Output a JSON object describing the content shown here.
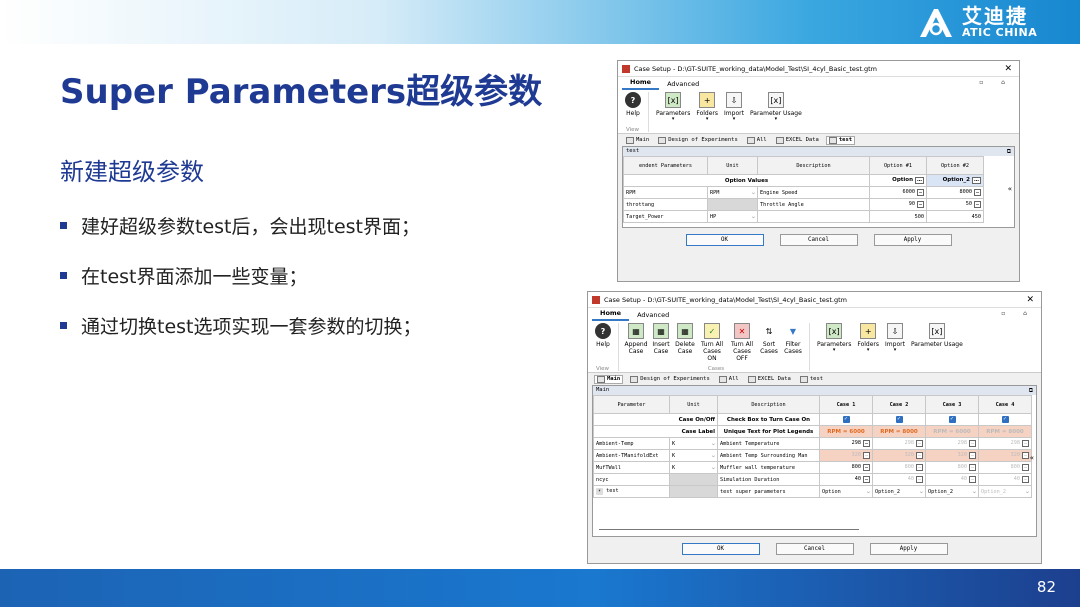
{
  "logo": {
    "cn": "艾迪捷",
    "en": "ATIC CHINA"
  },
  "slide": {
    "title": "Super Parameters超级参数",
    "subtitle": "新建超级参数",
    "bullets": [
      "建好超级参数test后，会出现test界面；",
      "在test界面添加一些变量；",
      "通过切换test选项实现一套参数的切换；"
    ],
    "page_number": "82"
  },
  "colors": {
    "title": "#1f3a93",
    "accent": "#1a78cf",
    "checkbox": "#2f6fc2"
  },
  "dialog1": {
    "title": "Case Setup - D:\\GT-SUITE_working_data\\Model_Test\\SI_4cyl_Basic_test.gtm",
    "close": "✕",
    "menu": [
      "Home",
      "Advanced"
    ],
    "menu_right": "▫ ⌂",
    "ribbon": {
      "help": "Help",
      "parameters": "Parameters",
      "folders": "Folders",
      "import": "Import",
      "parameter_usage": "Parameter Usage",
      "view_group": "View"
    },
    "tabs": [
      "Main",
      "Design of Experiments",
      "All",
      "EXCEL Data",
      "test"
    ],
    "panel_title": "test",
    "headers": [
      "endent Parameters",
      "Unit",
      "Description",
      "Option #1",
      "Option #2"
    ],
    "option_values_label": "Option Values",
    "option_values": [
      "Option",
      "Option_2"
    ],
    "rows": [
      {
        "name": "RPM",
        "unit": "RPM",
        "desc": "Engine Speed",
        "v1": "6000",
        "v2": "8000"
      },
      {
        "name": "throttang",
        "unit": "",
        "desc": "Throttle Angle",
        "v1": "90",
        "v2": "50"
      },
      {
        "name": "Target_Power",
        "unit": "HP",
        "desc": "",
        "v1": "500",
        "v2": "450"
      }
    ],
    "buttons": [
      "OK",
      "Cancel",
      "Apply"
    ]
  },
  "dialog2": {
    "title": "Case Setup - D:\\GT-SUITE_working_data\\Model_Test\\SI_4cyl_Basic_test.gtm",
    "close": "✕",
    "menu": [
      "Home",
      "Advanced"
    ],
    "menu_right": "▫ ⌂",
    "ribbon": {
      "help": "Help",
      "append": "Append Case",
      "insert": "Insert Case",
      "delete": "Delete Case",
      "turn_on": "Turn All Cases ON",
      "turn_off": "Turn All Cases OFF",
      "sort": "Sort Cases",
      "filter": "Filter Cases",
      "parameters": "Parameters",
      "folders": "Folders",
      "import": "Import",
      "parameter_usage": "Parameter Usage",
      "view_group": "View",
      "cases_group": "Cases"
    },
    "tabs": [
      "Main",
      "Design of Experiments",
      "All",
      "EXCEL Data",
      "test"
    ],
    "panel_title": "Main",
    "headers": [
      "Parameter",
      "Unit",
      "Description",
      "Case 1",
      "Case 2",
      "Case 3",
      "Case 4"
    ],
    "case_onoff": {
      "label": "Case On/Off",
      "desc": "Check Box to Turn Case On"
    },
    "case_label": {
      "label": "Case Label",
      "desc": "Unique Text for Plot Legends",
      "values": [
        "RPM = 6000",
        "RPM = 8000",
        "RPM = 6000",
        "RPM = 8000"
      ]
    },
    "rows": [
      {
        "name": "Ambient-Temp",
        "unit": "K",
        "desc": "Ambient Temperature",
        "values": [
          "298",
          "298",
          "298",
          "298"
        ]
      },
      {
        "name": "Ambient-TManifoldExt",
        "unit": "K",
        "desc": "Ambient Temp Surrounding Man",
        "values": [
          "320",
          "320",
          "320",
          "320"
        ]
      },
      {
        "name": "MufTWall",
        "unit": "K",
        "desc": "Muffler wall temperature",
        "values": [
          "800",
          "800",
          "800",
          "800"
        ]
      },
      {
        "name": "ncyc",
        "unit": "",
        "desc": "Simulation Duration",
        "values": [
          "40",
          "40",
          "40",
          "40"
        ]
      },
      {
        "name": "test",
        "unit": "",
        "desc": "test super parameters",
        "values": [
          "Option",
          "Option_2",
          "Option_2",
          "Option_2"
        ]
      }
    ],
    "buttons": [
      "OK",
      "Cancel",
      "Apply"
    ]
  }
}
